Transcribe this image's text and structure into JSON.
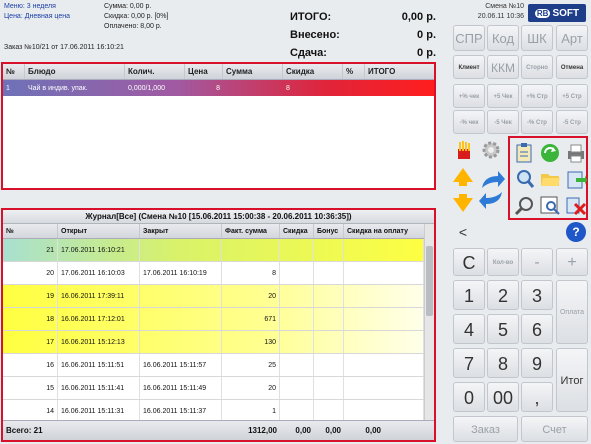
{
  "header": {
    "menu": "Меню: 3 неделя",
    "price": "Цена: Дневная цена",
    "sum": "Сумма: 0,00 р.",
    "discount": "Скидка: 0,00 р. [0%]",
    "paid": "Оплачено: 8,00 р.",
    "order": "Заказ №10/21 от 17.06.2011 16:10:21",
    "totals": [
      {
        "label": "ИТОГО:",
        "value": "0,00 р."
      },
      {
        "label": "Внесено:",
        "value": "0 р."
      },
      {
        "label": "Сдача:",
        "value": "0 р."
      }
    ],
    "shift_no": "Смена №10",
    "shift_date": "20.06.11 10:36",
    "logo_rb": "RB",
    "logo_soft": "SOFT"
  },
  "order_grid": {
    "columns": [
      "№",
      "Блюдо",
      "Колич.",
      "Цена",
      "Сумма",
      "Скидка",
      "%",
      "ИТОГО"
    ],
    "rows": [
      {
        "n": "1",
        "dish": "Чай в индив. упак.",
        "qty": "0,000/1,000",
        "price": "8",
        "sum": "",
        "disc": "8",
        "pct": "",
        "total": ""
      }
    ]
  },
  "journal": {
    "title": "Журнал[Все] (Смена №10 [15.06.2011 15:00:38 - 20.06.2011 10:36:35])",
    "columns": [
      "№",
      "Открыт",
      "Закрыт",
      "Факт. сумма",
      "Скидка",
      "Бонус",
      "Скидка на оплату"
    ],
    "rows": [
      {
        "n": "21",
        "open": "17.06.2011 16:10:21",
        "close": "",
        "sum": "",
        "style": "green"
      },
      {
        "n": "20",
        "open": "17.06.2011 16:10:03",
        "close": "17.06.2011 16:10:19",
        "sum": "8",
        "style": "white"
      },
      {
        "n": "19",
        "open": "16.06.2011 17:39:11",
        "close": "",
        "sum": "20",
        "style": "yellow"
      },
      {
        "n": "18",
        "open": "16.06.2011 17:12:01",
        "close": "",
        "sum": "671",
        "style": "yellow"
      },
      {
        "n": "17",
        "open": "16.06.2011 15:12:13",
        "close": "",
        "sum": "130",
        "style": "yellow"
      },
      {
        "n": "16",
        "open": "16.06.2011 15:11:51",
        "close": "16.06.2011 15:11:57",
        "sum": "25",
        "style": "white"
      },
      {
        "n": "15",
        "open": "16.06.2011 15:11:41",
        "close": "16.06.2011 15:11:49",
        "sum": "20",
        "style": "white"
      },
      {
        "n": "14",
        "open": "16.06.2011 15:11:31",
        "close": "16.06.2011 15:11:37",
        "sum": "1",
        "style": "white"
      }
    ],
    "footer": {
      "count": "Всего: 21",
      "sum": "1312,00",
      "disc": "0,00",
      "bonus": "0,00",
      "pay_disc": "0,00"
    }
  },
  "buttons": {
    "top": [
      "СПР",
      "Код",
      "ШК",
      "Арт"
    ],
    "row2": [
      "Клиент",
      "ККМ",
      "Сторно",
      "Отмена"
    ],
    "row3": [
      "+% чек",
      "+5 Чек",
      "+% Стр",
      "+5 Стр"
    ],
    "row4": [
      "-% чек",
      "-5 Чек",
      "-% Стр",
      "-5 Стр"
    ],
    "lt": "<",
    "help": "?",
    "c": "C",
    "qty": "Кол-во",
    "minus": "-",
    "plus": "+",
    "digits": [
      "1",
      "2",
      "3",
      "4",
      "5",
      "6",
      "7",
      "8",
      "9",
      "0",
      "00",
      ","
    ],
    "pay": "Оплата",
    "total": "Итог",
    "order": "Заказ",
    "bill": "Счет"
  },
  "colors": {
    "accent_red": "#d8102a",
    "row_green": "#c9ef9a",
    "row_yellow": "#ffff40",
    "brand_blue": "#1e3e8a"
  }
}
